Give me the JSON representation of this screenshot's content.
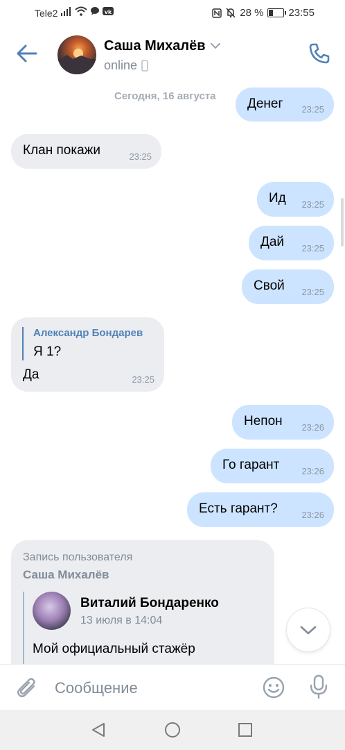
{
  "status_bar": {
    "carrier": "Tele2",
    "battery": "28 %",
    "time": "23:55"
  },
  "header": {
    "contact_name": "Саша Михалёв",
    "status": "online"
  },
  "date_separator": "Сегодня, 16 августа",
  "messages": [
    {
      "text": "Денег",
      "time": "23:25",
      "direction": "out"
    },
    {
      "text": "Клан покажи",
      "time": "23:25",
      "direction": "in"
    },
    {
      "text": "Ид",
      "time": "23:25",
      "direction": "out"
    },
    {
      "text": "Дай",
      "time": "23:25",
      "direction": "out"
    },
    {
      "text": "Свой",
      "time": "23:25",
      "direction": "out"
    },
    {
      "text": "Да",
      "time": "23:25",
      "direction": "in",
      "reply": {
        "name": "Александр Бондарев",
        "text": "Я 1?"
      }
    },
    {
      "text": "Непон",
      "time": "23:26",
      "direction": "out"
    },
    {
      "text": "Го гарант",
      "time": "23:26",
      "direction": "out"
    },
    {
      "text": "Есть гарант?",
      "time": "23:26",
      "direction": "out"
    }
  ],
  "repost": {
    "label": "Запись пользователя",
    "author": "Саша Михалёв",
    "inner_name": "Виталий Бондаренко",
    "inner_date": "13 июля в 14:04",
    "inner_text": "Мой официальный стажёр"
  },
  "composer": {
    "placeholder": "Сообщение"
  },
  "colors": {
    "accent": "#5181b8",
    "outgoing_bubble": "#cce4ff",
    "incoming_bubble": "#ebedf0"
  }
}
